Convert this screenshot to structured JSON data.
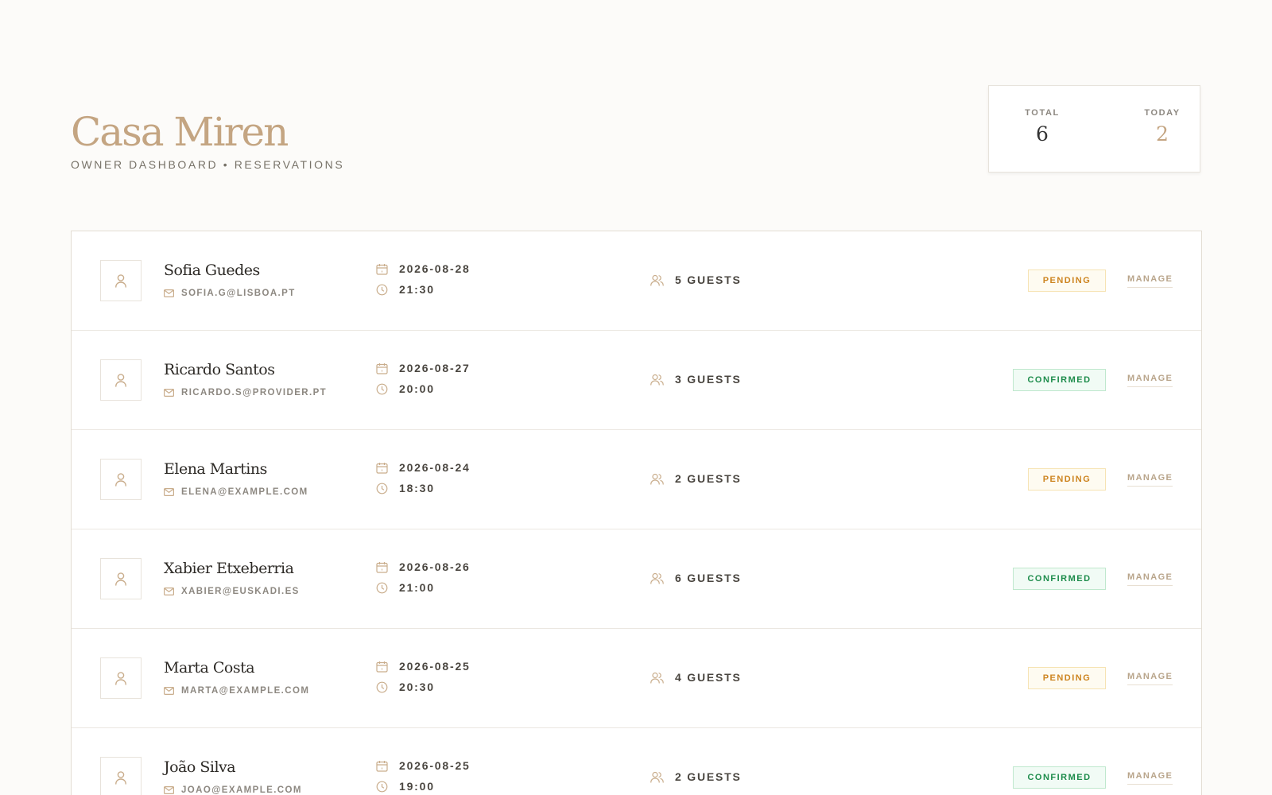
{
  "header": {
    "title": "Casa Miren",
    "subtitle": "OWNER DASHBOARD • RESERVATIONS"
  },
  "stats": {
    "total_label": "TOTAL",
    "total_value": "6",
    "today_label": "TODAY",
    "today_value": "2"
  },
  "colors": {
    "accent": "#c4a582",
    "pending": "#cd8521",
    "confirmed": "#1d8c4b"
  },
  "icons": {
    "avatar": "user-icon",
    "email": "mail-icon",
    "date": "calendar-icon",
    "time": "clock-icon",
    "guests": "users-icon"
  },
  "reservations": [
    {
      "name": "Sofia Guedes",
      "email": "SOFIA.G@LISBOA.PT",
      "date": "2026-08-28",
      "time": "21:30",
      "guests": "5 GUESTS",
      "status": "PENDING",
      "action": "MANAGE"
    },
    {
      "name": "Ricardo Santos",
      "email": "RICARDO.S@PROVIDER.PT",
      "date": "2026-08-27",
      "time": "20:00",
      "guests": "3 GUESTS",
      "status": "CONFIRMED",
      "action": "MANAGE"
    },
    {
      "name": "Elena Martins",
      "email": "ELENA@EXAMPLE.COM",
      "date": "2026-08-24",
      "time": "18:30",
      "guests": "2 GUESTS",
      "status": "PENDING",
      "action": "MANAGE"
    },
    {
      "name": "Xabier Etxeberria",
      "email": "XABIER@EUSKADI.ES",
      "date": "2026-08-26",
      "time": "21:00",
      "guests": "6 GUESTS",
      "status": "CONFIRMED",
      "action": "MANAGE"
    },
    {
      "name": "Marta Costa",
      "email": "MARTA@EXAMPLE.COM",
      "date": "2026-08-25",
      "time": "20:30",
      "guests": "4 GUESTS",
      "status": "PENDING",
      "action": "MANAGE"
    },
    {
      "name": "João Silva",
      "email": "JOAO@EXAMPLE.COM",
      "date": "2026-08-25",
      "time": "19:00",
      "guests": "2 GUESTS",
      "status": "CONFIRMED",
      "action": "MANAGE"
    }
  ]
}
